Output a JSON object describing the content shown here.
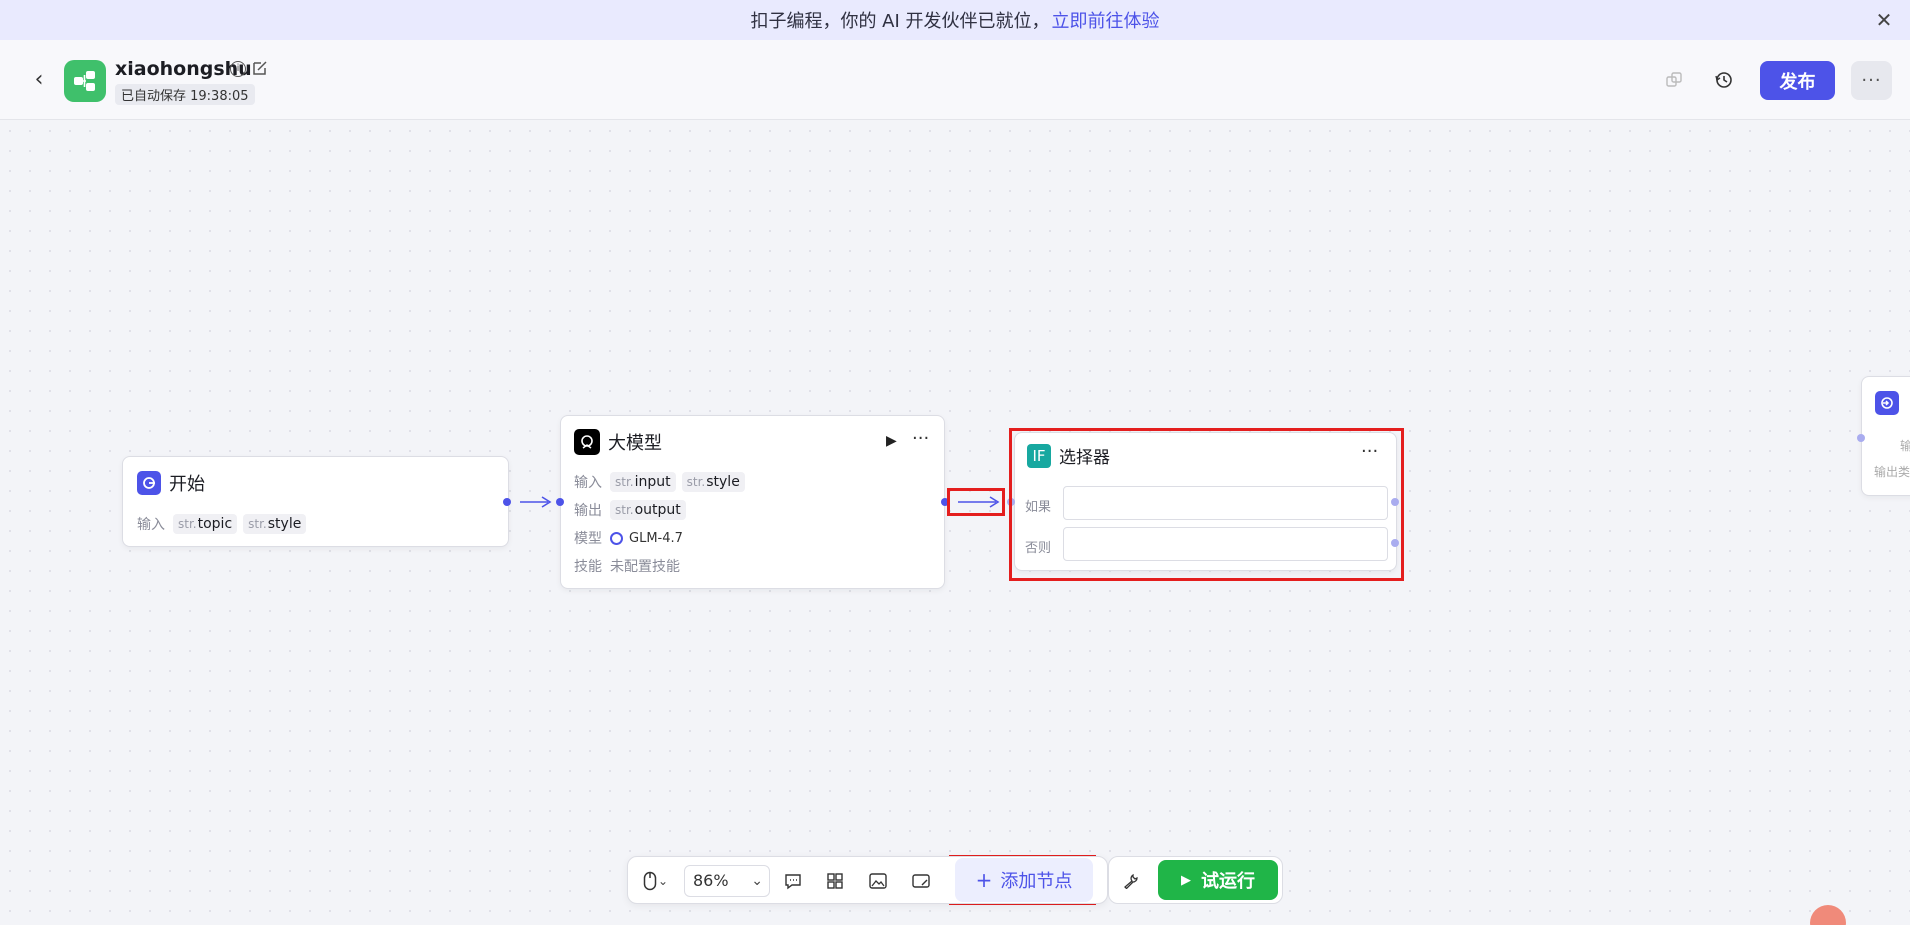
{
  "banner": {
    "text": "扣子编程，你的 AI 开发伙伴已就位，",
    "link": "立即前往体验",
    "close_icon": "close-icon"
  },
  "header": {
    "app_name": "xiaohongshu",
    "autosave": "已自动保存 19:38:05",
    "publish_label": "发布",
    "more_label": "···"
  },
  "nodes": {
    "start": {
      "title": "开始",
      "input_label": "输入",
      "inputs": [
        {
          "type": "str.",
          "name": "topic"
        },
        {
          "type": "str.",
          "name": "style"
        }
      ]
    },
    "llm": {
      "title": "大模型",
      "input_label": "输入",
      "inputs": [
        {
          "type": "str.",
          "name": "input"
        },
        {
          "type": "str.",
          "name": "style"
        }
      ],
      "output_label": "输出",
      "outputs": [
        {
          "type": "str.",
          "name": "output"
        }
      ],
      "model_label": "模型",
      "model": "GLM-4.7",
      "skill_label": "技能",
      "skill": "未配置技能"
    },
    "selector": {
      "title": "选择器",
      "icon_text": "IF",
      "if_label": "如果",
      "else_label": "否则"
    },
    "partial_right": {
      "label_1": "输",
      "label_2": "输出类"
    }
  },
  "toolbar": {
    "zoom": "86%",
    "add_node_label": "添加节点",
    "run_label": "试运行"
  },
  "colors": {
    "accent": "#4d53e8",
    "run_green": "#20b548",
    "app_icon_green": "#3fc06b",
    "highlight_red": "#e41e1e"
  }
}
